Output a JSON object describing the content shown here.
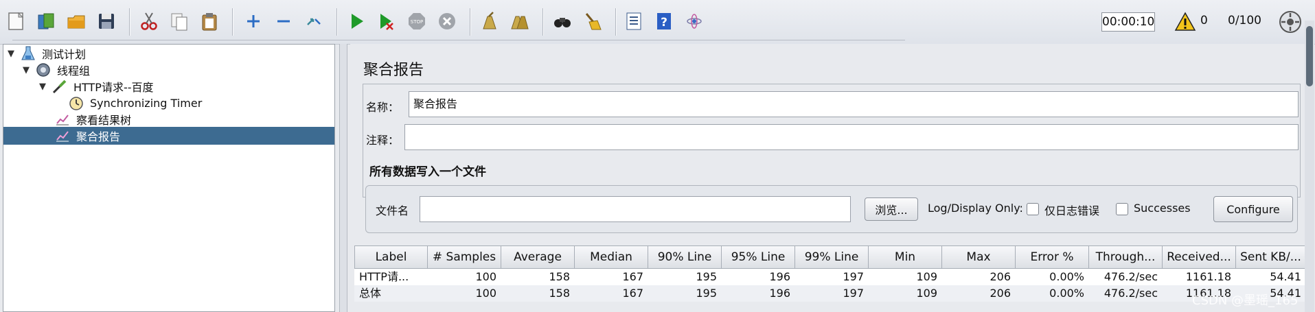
{
  "toolbar": {
    "buttons": [
      {
        "name": "new-icon",
        "color": "#f2f2f2"
      },
      {
        "name": "templates-icon",
        "color": "#3b7bbf"
      },
      {
        "name": "open-icon",
        "color": "#e0a020"
      },
      {
        "name": "save-icon",
        "color": "#2f3e56"
      },
      {
        "name": "cut-icon",
        "color": "#c02020"
      },
      {
        "name": "copy-icon",
        "color": "#d0d4da"
      },
      {
        "name": "paste-icon",
        "color": "#b58a4a"
      },
      {
        "name": "expand-icon",
        "color": "#2b6cc4"
      },
      {
        "name": "collapse-icon",
        "color": "#2b6cc4"
      },
      {
        "name": "toggle-icon",
        "color": "#3a8a9a"
      },
      {
        "name": "start-icon",
        "color": "#1f9a2a"
      },
      {
        "name": "start-no-pauses-icon",
        "color": "#1f9a2a"
      },
      {
        "name": "stop-icon",
        "color": "#a0a4aa"
      },
      {
        "name": "shutdown-icon",
        "color": "#a0a4aa"
      },
      {
        "name": "clear-icon",
        "color": "#b5912f"
      },
      {
        "name": "clear-all-icon",
        "color": "#b5912f"
      },
      {
        "name": "search-icon",
        "color": "#222222"
      },
      {
        "name": "reset-search-icon",
        "color": "#e0b020"
      },
      {
        "name": "function-helper-icon",
        "color": "#3a5a8a"
      },
      {
        "name": "help-icon",
        "color": "#2a5ec4"
      },
      {
        "name": "remote-icon",
        "color": "#7a7aa8"
      }
    ],
    "timer": "00:00:10",
    "warning_count": "0",
    "thread_count": "0/100"
  },
  "tree": {
    "items": [
      {
        "label": "测试计划",
        "icon": "test-plan-icon"
      },
      {
        "label": "线程组",
        "icon": "thread-group-icon"
      },
      {
        "label": "HTTP请求--百度",
        "icon": "sampler-icon"
      },
      {
        "label": "Synchronizing Timer",
        "icon": "timer-icon"
      },
      {
        "label": "察看结果树",
        "icon": "listener-icon"
      },
      {
        "label": "聚合报告",
        "icon": "listener-icon"
      }
    ]
  },
  "panel": {
    "title": "聚合报告",
    "name_label": "名称：",
    "name_value": "聚合报告",
    "comment_label": "注释：",
    "comment_value": "",
    "file_group_title": "所有数据写入一个文件",
    "filename_label": "文件名",
    "filename_value": "",
    "browse_label": "浏览...",
    "log_display_label": "Log/Display Only:",
    "errors_label": "仅日志错误",
    "successes_label": "Successes",
    "configure_label": "Configure"
  },
  "table": {
    "columns": [
      "Label",
      "# Samples",
      "Average",
      "Median",
      "90% Line",
      "95% Line",
      "99% Line",
      "Min",
      "Max",
      "Error %",
      "Through...",
      "Received...",
      "Sent KB/..."
    ],
    "rows": [
      [
        "HTTP请...",
        "100",
        "158",
        "167",
        "195",
        "196",
        "197",
        "109",
        "206",
        "0.00%",
        "476.2/sec",
        "1161.18",
        "54.41"
      ],
      [
        "总体",
        "100",
        "158",
        "167",
        "195",
        "196",
        "197",
        "109",
        "206",
        "0.00%",
        "476.2/sec",
        "1161.18",
        "54.41"
      ]
    ]
  },
  "watermark": "CSDN @墨瑶_165"
}
